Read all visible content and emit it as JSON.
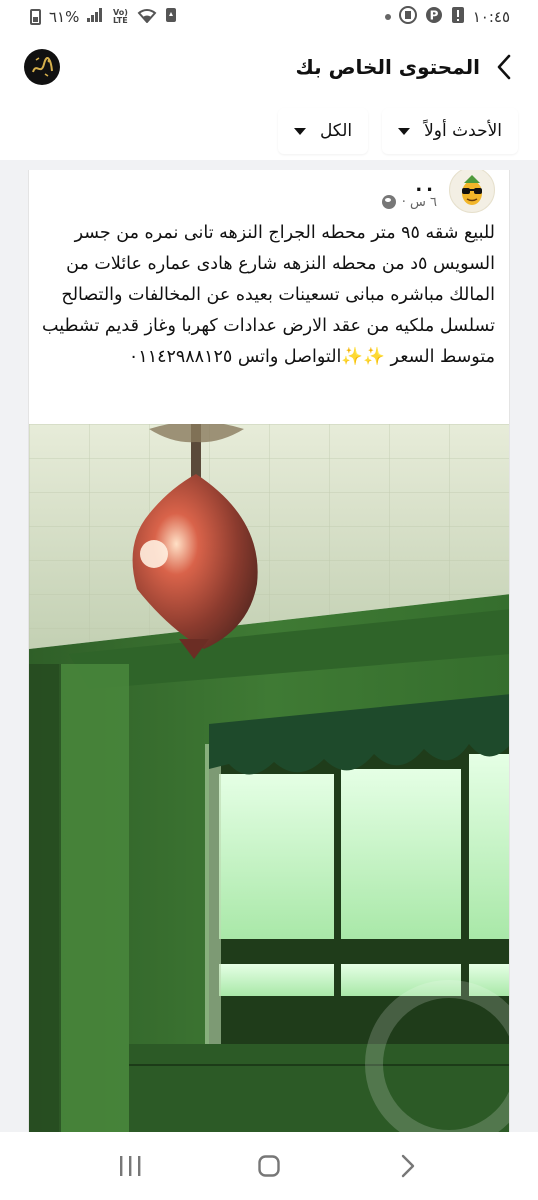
{
  "status_bar": {
    "time": "١٠:٤٥",
    "battery_percent": "٦١%",
    "network_label": "Vo) LTE"
  },
  "header": {
    "title": "المحتوى الخاص بك",
    "back_icon": "chevron-left-icon",
    "logo_text": "محمد"
  },
  "filters": {
    "sort_label": "الأحدث أولاً",
    "type_label": "الكل"
  },
  "post": {
    "author_name": "..",
    "time_ago": "٦ س ·",
    "privacy_icon": "globe-icon",
    "text": "للبيع شقه ٩٥ متر محطه الجراج النزهه تانى نمره من جسر السويس ٥د من محطه النزهه شارع هادى عماره  عائلات من المالك مباشره مبانى تسعينات بعيده عن المخالفات والتصالح تسلسل ملكيه من عقد الارض عدادات كهربا وغاز قديم  تشطيب متوسط السعر ✨✨التواصل واتس ٠١١٤٢٩٨٨١٢٥"
  },
  "nav": {
    "recent_icon": "recent-apps-icon",
    "home_icon": "home-icon",
    "back_icon": "back-icon"
  },
  "colors": {
    "feed_background": "#f1f2f4",
    "wall_green": "#3f7a34",
    "window_glow": "#c9f2c9"
  }
}
